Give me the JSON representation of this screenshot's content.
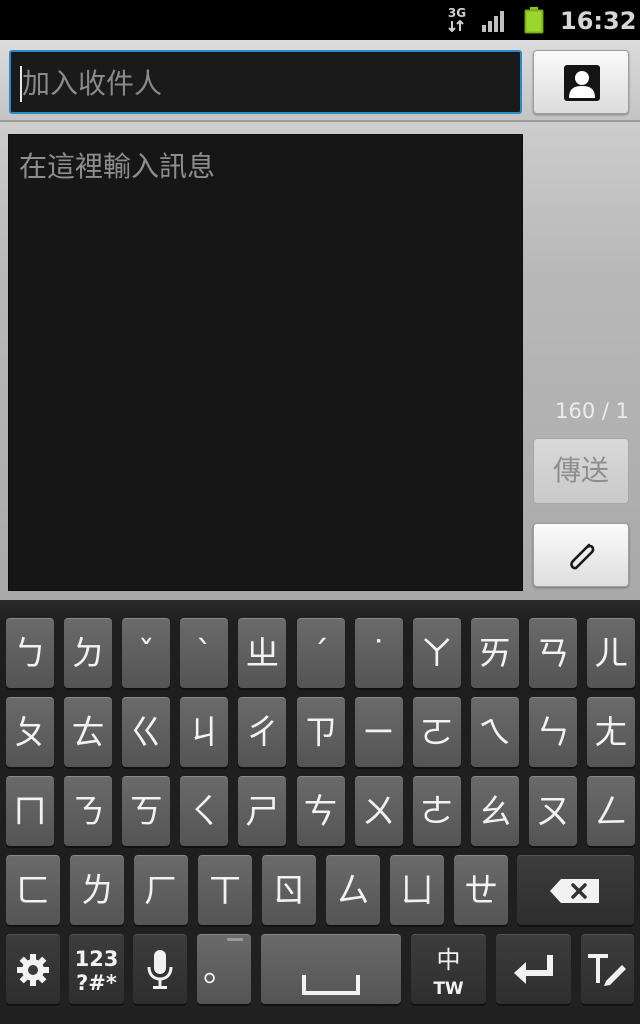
{
  "status_bar": {
    "network": "3G",
    "time": "16:32",
    "icons": [
      "network-3g-icon",
      "signal-icon",
      "battery-icon"
    ]
  },
  "compose": {
    "recipient_placeholder": "加入收件人",
    "message_placeholder": "在這裡輸入訊息",
    "counter": "160 / 1",
    "send_label": "傳送",
    "contact_icon": "contact-icon",
    "attach_icon": "paperclip-icon"
  },
  "keyboard": {
    "row1": [
      "ㄅ",
      "ㄉ",
      "ˇ",
      "ˋ",
      "ㄓ",
      "ˊ",
      "˙",
      "ㄚ",
      "ㄞ",
      "ㄢ",
      "ㄦ"
    ],
    "row2": [
      "ㄆ",
      "ㄊ",
      "ㄍ",
      "ㄐ",
      "ㄔ",
      "ㄗ",
      "ㄧ",
      "ㄛ",
      "ㄟ",
      "ㄣ",
      "ㄤ"
    ],
    "row3": [
      "ㄇ",
      "ㄋ",
      "ㄎ",
      "ㄑ",
      "ㄕ",
      "ㄘ",
      "ㄨ",
      "ㄜ",
      "ㄠ",
      "ㄡ",
      "ㄥ"
    ],
    "row4": [
      "ㄈ",
      "ㄌ",
      "ㄏ",
      "ㄒ",
      "ㄖ",
      "ㄙ",
      "ㄩ",
      "ㄝ"
    ],
    "symbols_key": {
      "line1": "123",
      "line2": "?#*"
    },
    "period_key": "。",
    "lang_key": {
      "line1": "中",
      "line2": "TW"
    },
    "icons": [
      "settings-icon",
      "microphone-icon",
      "space-icon",
      "backspace-icon",
      "enter-icon",
      "handwriting-icon"
    ]
  }
}
